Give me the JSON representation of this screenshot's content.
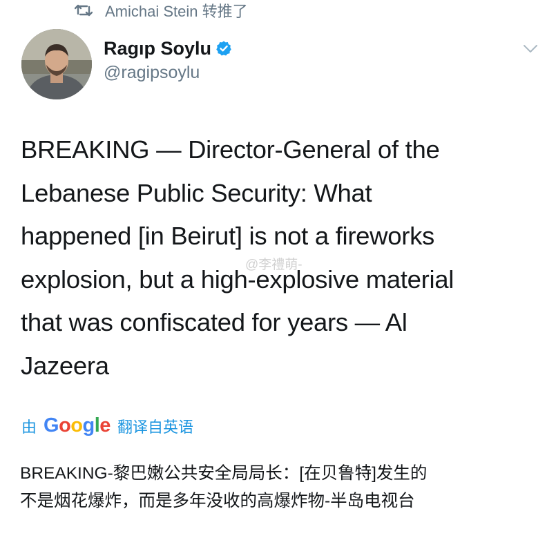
{
  "retweet": {
    "icon": "retweet-icon",
    "text": "Amichai Stein 转推了"
  },
  "author": {
    "name": "Ragıp Soylu",
    "handle": "@ragipsoylu",
    "verified_icon": "verified-badge-icon",
    "verified_color": "#1da1f2"
  },
  "tweet": {
    "text": "BREAKING — Director-General of the\nLebanese Public Security: What\nhappened [in Beirut] is not a fireworks\nexplosion, but a high-explosive material\nthat was confiscated for years  — Al\nJazeera"
  },
  "watermark": "@李禮萌-",
  "translation": {
    "prefix": "由",
    "provider": "Google",
    "suffix": "翻译自英语",
    "link_color": "#1b95e0",
    "text": "BREAKING-黎巴嫩公共安全局局长：[在贝鲁特]发生的\n不是烟花爆炸，而是多年没收的高爆炸物-半岛电视台"
  },
  "menu_icon": "chevron-down-icon"
}
